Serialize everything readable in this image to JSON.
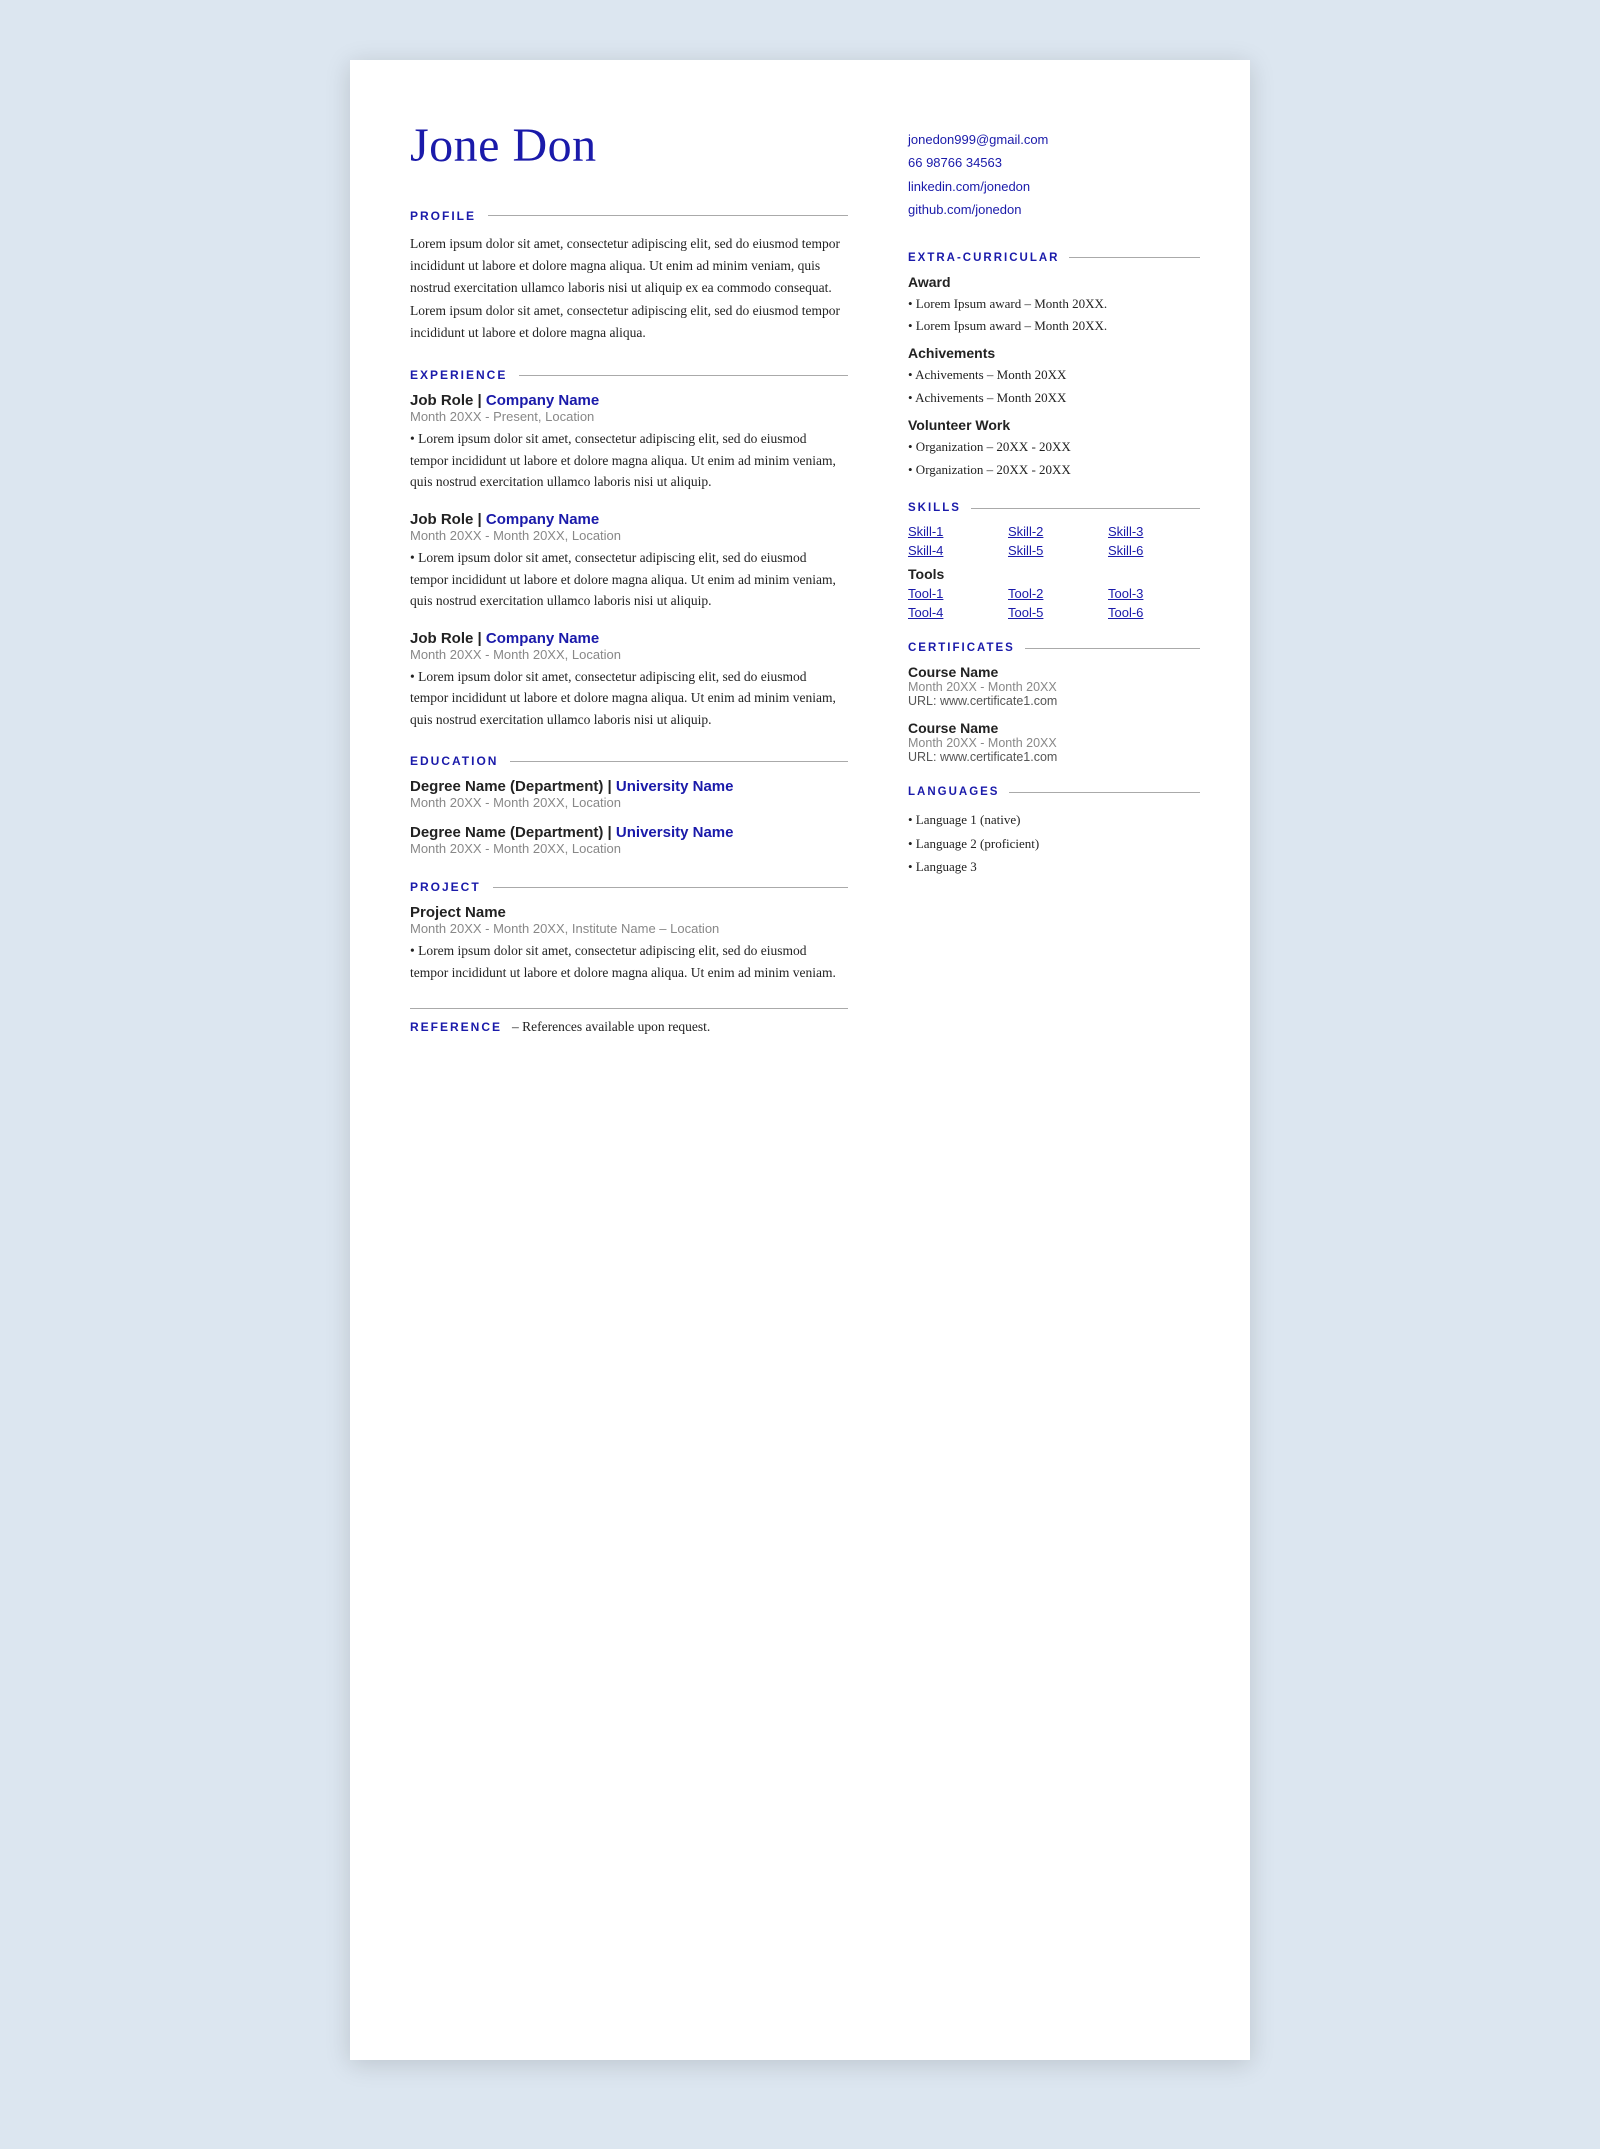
{
  "page": {
    "background": "#dce6f0"
  },
  "name": "Jone Don",
  "contact": {
    "email": "jonedon999@gmail.com",
    "phone": "66 98766 34563",
    "linkedin": "linkedin.com/jonedon",
    "github": "github.com/jonedon"
  },
  "sections": {
    "profile": {
      "title": "PROFILE",
      "text": "Lorem ipsum dolor sit amet, consectetur adipiscing elit, sed do eiusmod tempor incididunt ut labore et dolore magna aliqua. Ut enim ad minim veniam, quis nostrud exercitation ullamco laboris nisi ut aliquip ex ea commodo consequat. Lorem ipsum dolor sit amet, consectetur adipiscing elit, sed do eiusmod tempor incididunt ut labore et dolore magna aliqua."
    },
    "experience": {
      "title": "EXPERIENCE",
      "entries": [
        {
          "role": "Job Role",
          "company": "Company Name",
          "date": "Month 20XX - Present, Location",
          "desc": "• Lorem ipsum dolor sit amet, consectetur adipiscing elit, sed do eiusmod tempor incididunt ut labore et dolore magna aliqua. Ut enim ad minim veniam, quis nostrud exercitation ullamco laboris nisi ut aliquip."
        },
        {
          "role": "Job Role",
          "company": "Company Name",
          "date": "Month 20XX - Month 20XX, Location",
          "desc": "• Lorem ipsum dolor sit amet, consectetur adipiscing elit, sed do eiusmod tempor incididunt ut labore et dolore magna aliqua. Ut enim ad minim veniam, quis nostrud exercitation ullamco laboris nisi ut aliquip."
        },
        {
          "role": "Job Role",
          "company": "Company Name",
          "date": "Month 20XX - Month 20XX, Location",
          "desc": "• Lorem ipsum dolor sit amet, consectetur adipiscing elit, sed do eiusmod tempor incididunt ut labore et dolore magna aliqua. Ut enim ad minim veniam, quis nostrud exercitation ullamco laboris nisi ut aliquip."
        }
      ]
    },
    "education": {
      "title": "EDUCATION",
      "entries": [
        {
          "degree": "Degree Name (Department)",
          "university": "University Name",
          "date": "Month 20XX - Month 20XX, Location"
        },
        {
          "degree": "Degree Name (Department)",
          "university": "University Name",
          "date": "Month 20XX - Month 20XX, Location"
        }
      ]
    },
    "project": {
      "title": "PROJECT",
      "entries": [
        {
          "name": "Project Name",
          "date": "Month 20XX - Month 20XX, Institute Name – Location",
          "desc": "• Lorem ipsum dolor sit amet, consectetur adipiscing elit, sed do eiusmod tempor incididunt ut labore et dolore magna aliqua. Ut enim ad minim veniam."
        }
      ]
    },
    "reference": {
      "label": "REFERENCE",
      "text": "– References available upon request."
    }
  },
  "right": {
    "extra_curricular": {
      "title": "EXTRA-CURRICULAR",
      "award": {
        "label": "Award",
        "items": [
          "• Lorem Ipsum award – Month 20XX.",
          "• Lorem Ipsum award – Month 20XX."
        ]
      },
      "achievements": {
        "label": "Achivements",
        "items": [
          "• Achivements – Month 20XX",
          "• Achivements – Month 20XX"
        ]
      },
      "volunteer": {
        "label": "Volunteer Work",
        "items": [
          "• Organization – 20XX - 20XX",
          "• Organization – 20XX - 20XX"
        ]
      }
    },
    "skills": {
      "title": "SKILLS",
      "skills": [
        "Skill-1",
        "Skill-2",
        "Skill-3",
        "Skill-4",
        "Skill-5",
        "Skill-6"
      ],
      "tools_label": "Tools",
      "tools": [
        "Tool-1",
        "Tool-2",
        "Tool-3",
        "Tool-4",
        "Tool-5",
        "Tool-6"
      ]
    },
    "certificates": {
      "title": "CERTIFICATES",
      "entries": [
        {
          "name": "Course Name",
          "date": "Month 20XX - Month 20XX",
          "url": "URL: www.certificate1.com"
        },
        {
          "name": "Course Name",
          "date": "Month 20XX - Month 20XX",
          "url": "URL: www.certificate1.com"
        }
      ]
    },
    "languages": {
      "title": "LANGUAGES",
      "items": [
        "• Language 1 (native)",
        "• Language 2 (proficient)",
        "• Language 3"
      ]
    }
  }
}
